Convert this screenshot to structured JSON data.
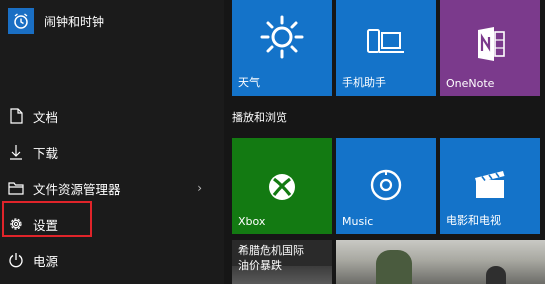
{
  "app": {
    "name": "闹钟和时钟",
    "icon": "alarm-clock-icon",
    "color": "#1a6fc4"
  },
  "menu": [
    {
      "label": "文档",
      "icon": "document-icon"
    },
    {
      "label": "下载",
      "icon": "download-icon"
    },
    {
      "label": "文件资源管理器",
      "icon": "file-explorer-icon",
      "arrow": "›"
    },
    {
      "label": "设置",
      "icon": "gear-icon"
    },
    {
      "label": "电源",
      "icon": "power-icon"
    }
  ],
  "tiles": {
    "weather": {
      "label": "天气",
      "icon": "sun-icon",
      "color": "#1473c9"
    },
    "phone": {
      "label": "手机助手",
      "icon": "phone-laptop-icon",
      "color": "#1473c9"
    },
    "onenote": {
      "label": "OneNote",
      "icon": "onenote-icon",
      "color": "#7b3a8c"
    },
    "xbox": {
      "label": "Xbox",
      "icon": "xbox-icon",
      "color": "#137a12"
    },
    "music": {
      "label": "Music",
      "icon": "music-disc-icon",
      "color": "#1473c9"
    },
    "movies": {
      "label": "电影和电视",
      "icon": "clapperboard-icon",
      "color": "#1473c9"
    }
  },
  "group_title": "播放和浏览",
  "news": {
    "line1": "希腊危机国际",
    "line2": "油价暴跌"
  },
  "colors": {
    "highlight": "#e0242a",
    "background": "#1b1b1b"
  }
}
